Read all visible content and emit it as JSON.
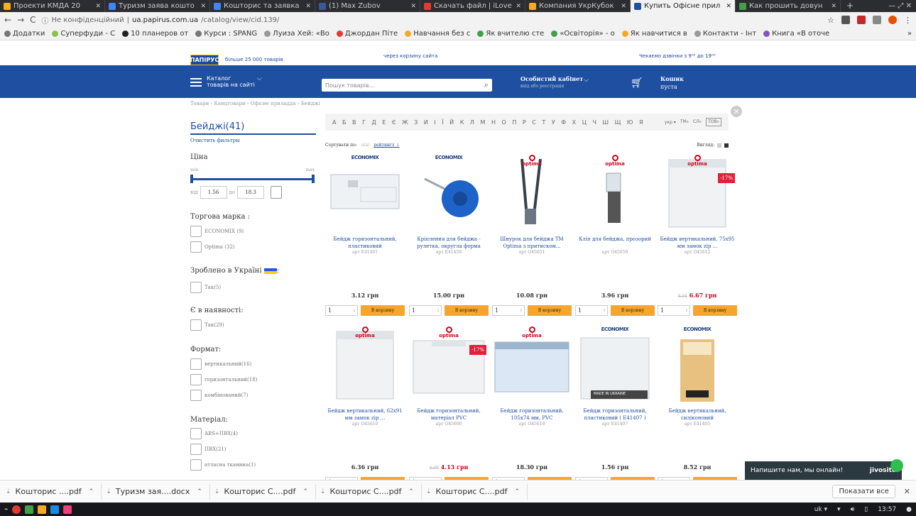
{
  "browser": {
    "tabs": [
      {
        "label": "Проекти КМДА 20",
        "color": "#f4b400"
      },
      {
        "label": "Туризм заява кошто",
        "color": "#4285f4"
      },
      {
        "label": "Кошторис та заявка",
        "color": "#4285f4"
      },
      {
        "label": "(1) Max Zubov",
        "color": "#3b5998"
      },
      {
        "label": "Скачать файл | iLove",
        "color": "#e53935"
      },
      {
        "label": "Компания УкрКубок",
        "color": "#f9a825"
      },
      {
        "label": "Купить Офісне прил",
        "color": "#1e4fa0"
      },
      {
        "label": "Как прошить довун",
        "color": "#43a047"
      }
    ],
    "active_tab": 6,
    "newtab": "+",
    "window_controls": "— ⤢ ✕",
    "security": "Не конфіденційний",
    "url_host": "ua.papirus.com.ua",
    "url_path": "/catalog/view/cid.139/",
    "bookmarks": [
      {
        "label": "Додатки",
        "color": "#777"
      },
      {
        "label": "Суперфуди - С",
        "color": "#8bc34a"
      },
      {
        "label": "10 планеров от",
        "color": "#222"
      },
      {
        "label": "Курси : SPANG",
        "color": "#777"
      },
      {
        "label": "Луиза Хей: «Во",
        "color": "#999"
      },
      {
        "label": "Джордан Піте",
        "color": "#e53935"
      },
      {
        "label": "Навчання без с",
        "color": "#f9a825"
      },
      {
        "label": "Як вчителю сте",
        "color": "#43a047"
      },
      {
        "label": "«Освіторія» - о",
        "color": "#43a047"
      },
      {
        "label": "Як навчитися в",
        "color": "#f9a825"
      },
      {
        "label": "Контакти - Інт",
        "color": "#999"
      },
      {
        "label": "Книга «В оточе",
        "color": "#7e57c2"
      }
    ],
    "bookmarks_more": "»"
  },
  "site": {
    "logo": "ПАПІРУС",
    "logo_sub": "більше 25 000 товарів",
    "top_mid": "через корзину сайта",
    "top_right": "Чекаємо дзвінки з 9⁰⁰ до 19⁰⁰",
    "catalog_label": "Каталог",
    "catalog_sub": "товарів на сайті",
    "search_placeholder": "Пошук товарів...",
    "cabinet": "Особистий кабінет",
    "cabinet_sub": "вхід або реєстрація",
    "cart_label": "Кошик",
    "cart_status": "пуста"
  },
  "breadcrumb": "Товари  ›  Канцтовари  ›  Офісне приладдя  ›  Бейджі",
  "filters": {
    "title": "Бейджі(41)",
    "clear": "Очистить фильтры",
    "price_label": "Ціна",
    "min": "min",
    "max": "max",
    "from": "від",
    "to": "до",
    "price_from": "1.56",
    "price_to": "18.3",
    "price_from_frac": 0.0,
    "price_to_frac": 1.0,
    "brand_label": "Торгова марка :",
    "brands": [
      "ECONOMIX (9)",
      "Optima (32)"
    ],
    "ukraine_label": "Зроблено в Україні",
    "ukraine_colon": ":",
    "ukraine_opts": [
      "Так(5)"
    ],
    "stock_label": "Є в наявності:",
    "stock_opts": [
      "Так(29)"
    ],
    "format_label": "Формат:",
    "formats": [
      "вертикальний(16)",
      "горизонтальний(18)",
      "комбінований(7)"
    ],
    "material_label": "Матеріал:",
    "materials": [
      "ABS+ПВХ(4)",
      "ПВХ(21)",
      "атласна тканина(1)"
    ]
  },
  "alphabet": "А Б В Г Д Е Є Ж З И І Ї Й К Л М Н О П Р С Т У Ф Х Ц Ч Ш Щ Ю Я",
  "alpha_ctrl": {
    "lang": "укр ▾",
    "tm": "ТМ",
    "sl": "СЛ",
    "tov": "ТОВ"
  },
  "sort": {
    "label": "Сортувати по:",
    "opt1": "ціні",
    "opt2": "рейтингу ↓"
  },
  "view": {
    "label": "Вигляд:"
  },
  "cart_btn": "В корзину",
  "qty_default": "1",
  "products": [
    {
      "brand": "ECONOMIX",
      "brand_kind": "eco",
      "name": "Бейдж горизонтальний, пластиковий",
      "art": "арт E41401",
      "price": "3.12 грн",
      "old": "",
      "sale": "",
      "img": "horiz-clip"
    },
    {
      "brand": "ECONOMIX",
      "brand_kind": "eco",
      "name": "Кріплення для бейджа - рулетка, округла форма",
      "art": "арт E41450",
      "price": "15.00 грн",
      "old": "",
      "sale": "",
      "img": "reel"
    },
    {
      "brand": "optima",
      "brand_kind": "opt",
      "name": "Шнурок для бейджа ТМ Optima з притиском...",
      "art": "арт O45651",
      "price": "10.08 грн",
      "old": "",
      "sale": "",
      "img": "lanyard"
    },
    {
      "brand": "optima",
      "brand_kind": "opt",
      "name": "Кліп для бейджа, прозорий",
      "art": "арт O45650",
      "price": "3.96 грн",
      "old": "",
      "sale": "",
      "img": "clip"
    },
    {
      "brand": "optima",
      "brand_kind": "opt",
      "name": "Бейдж вертикальний, 75x95 мм замок zip ...",
      "art": "арт O45612",
      "price": "6.67 грн",
      "old": "8.04",
      "sale": "-17%",
      "img": "vert-zip"
    },
    {
      "brand": "optima",
      "brand_kind": "opt",
      "name": "Бейдж вертикальний, 62x91 мм замок zip ...",
      "art": "арт O45610",
      "price": "6.36 грн",
      "old": "",
      "sale": "",
      "img": "vert-zip"
    },
    {
      "brand": "optima",
      "brand_kind": "opt",
      "name": "Бейдж горизонтальний, матеріал PVC",
      "art": "арт O45600",
      "price": "4.13 грн",
      "old": "4.98",
      "sale": "-17%",
      "img": "horiz-pvc"
    },
    {
      "brand": "optima",
      "brand_kind": "opt",
      "name": "Бейдж горизонтальний, 105x74 мм, PVC",
      "art": "арт O45619",
      "price": "18.30 грн",
      "old": "",
      "sale": "",
      "img": "horiz-blue"
    },
    {
      "brand": "ECONOMIX",
      "brand_kind": "eco",
      "name": "Бейдж горизонтальний, пластиковий ( E41407 )",
      "art": "арт E41407",
      "price": "1.56 грн",
      "old": "",
      "sale": "",
      "img": "made-ua"
    },
    {
      "brand": "ECONOMIX",
      "brand_kind": "eco",
      "name": "Бейдж вертикальний, силіконовий",
      "art": "арт E41405",
      "price": "8.52 грн",
      "old": "",
      "sale": "",
      "img": "orange-pack"
    }
  ],
  "made_in_ukraine": "MADE IN UKRAINE",
  "chat": {
    "text": "Напишите нам, мы онлайн!",
    "brand": "jivosite"
  },
  "downloads": [
    "Кошторис ....pdf",
    "Туризм зая....docx",
    "Кошторис С....pdf",
    "Кошторис С....pdf",
    "Кошторис С....pdf"
  ],
  "show_all": "Показати все",
  "taskbar": {
    "lang": "uk ▾",
    "time": "13:57"
  }
}
